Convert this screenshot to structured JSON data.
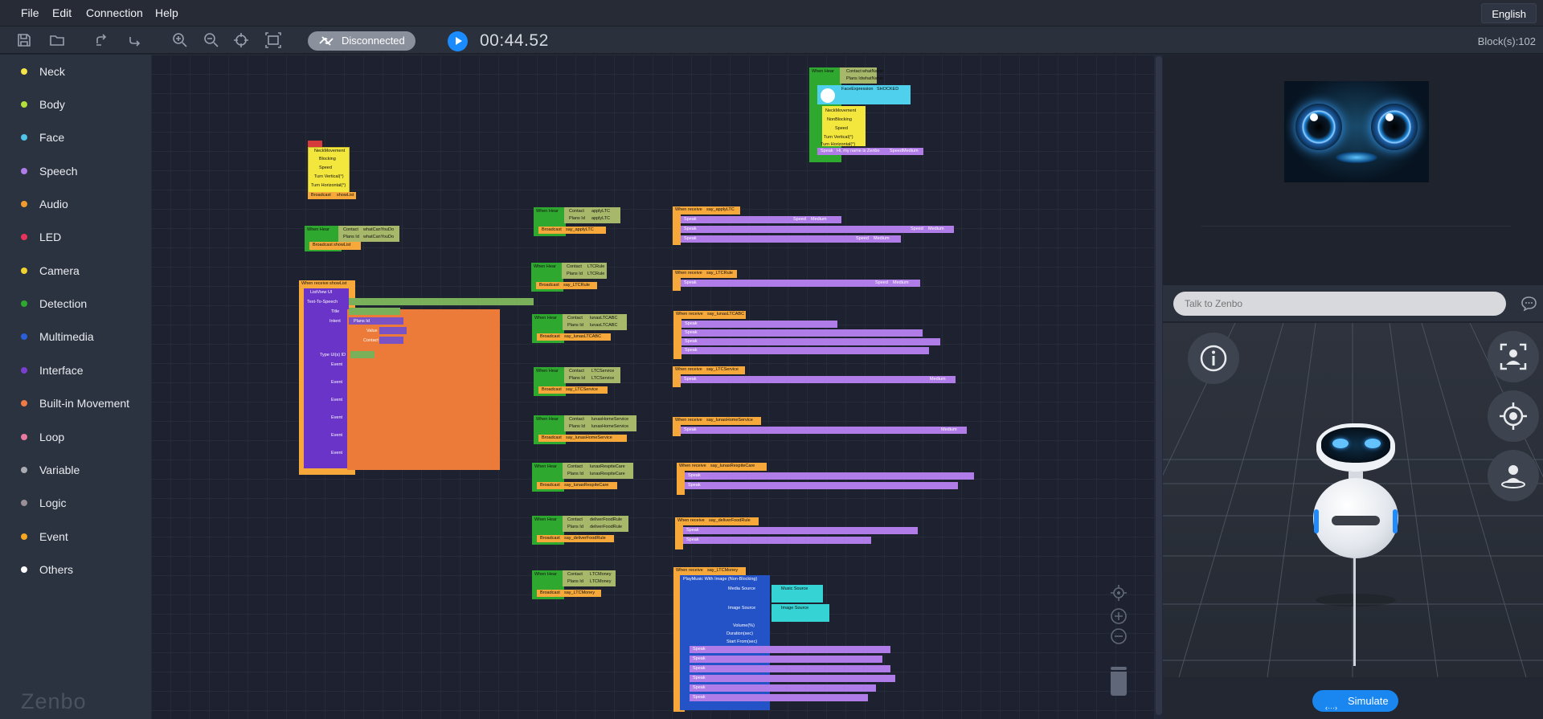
{
  "menu": {
    "file": "File",
    "edit": "Edit",
    "connection": "Connection",
    "help": "Help",
    "language": "English"
  },
  "toolbar": {
    "connection_status": "Disconnected",
    "timer": "00:44.52",
    "block_count": "Block(s):102"
  },
  "categories": [
    {
      "label": "Neck",
      "color": "#f5e447"
    },
    {
      "label": "Body",
      "color": "#b3e03a"
    },
    {
      "label": "Face",
      "color": "#4fc3e8"
    },
    {
      "label": "Speech",
      "color": "#b07ce8"
    },
    {
      "label": "Audio",
      "color": "#f29a2e"
    },
    {
      "label": "LED",
      "color": "#e8345a"
    },
    {
      "label": "Camera",
      "color": "#f2d22e"
    },
    {
      "label": "Detection",
      "color": "#2fa830"
    },
    {
      "label": "Multimedia",
      "color": "#2b5fd9"
    },
    {
      "label": "Interface",
      "color": "#7a3fd0"
    },
    {
      "label": "Built-in Movement",
      "color": "#f07a45"
    },
    {
      "label": "Loop",
      "color": "#e87aa0"
    },
    {
      "label": "Variable",
      "color": "#a9abb0"
    },
    {
      "label": "Logic",
      "color": "#9a8f96"
    },
    {
      "label": "Event",
      "color": "#f5a623"
    },
    {
      "label": "Others",
      "color": "#ffffff"
    }
  ],
  "brand": "Zenbo",
  "blocks": {
    "neck_top": [
      "NeckMovement",
      "Blocking",
      "Speed",
      "Turn Vertical(°)",
      "Turn Horizontal(°)",
      "Broadcast",
      "showList"
    ],
    "hear_top": [
      "When Hear",
      "Contact",
      "whatCanYouDo",
      "Plans Id",
      "whatCanYouDo",
      "Broadcast",
      "showList"
    ],
    "list_view": [
      "When receive",
      "showList",
      "ListView UI",
      "Text-To-Speech",
      "Title",
      "Intent",
      "Plans Id",
      "Value",
      "Contact",
      "Type Ui(s) ID",
      "Event",
      "Event",
      "Event",
      "Event",
      "Event",
      "Event",
      "Event",
      "Event",
      "Event"
    ],
    "start_block": [
      "When Hear",
      "Contact",
      "whatName",
      "Plans Id",
      "whatName",
      "FaceExpression",
      "SHOCKED",
      "NeckMovement",
      "NonBlocking",
      "Speed",
      "Turn Vertical(°)",
      "Turn Horizontal(°)",
      "Speak",
      "Hi, my name is Zenbo",
      "Speed",
      "Medium"
    ],
    "hear_blocks": [
      {
        "contact": "applyLTC",
        "plans": "applyLTC",
        "broadcast": "say_applyLTC"
      },
      {
        "contact": "LTCRule",
        "plans": "LTCRule",
        "broadcast": "say_LTCRule"
      },
      {
        "contact": "lunasLTCABC",
        "plans": "lunasLTCABC",
        "broadcast": "say_lunasLTCABC"
      },
      {
        "contact": "LTCService",
        "plans": "LTCService",
        "broadcast": "say_LTCService"
      },
      {
        "contact": "lunasHomeService",
        "plans": "lunasHomeService",
        "broadcast": "say_lunasHomeService"
      },
      {
        "contact": "lunasRespiteCare",
        "plans": "lunasRespiteCare",
        "broadcast": "say_lunasRespiteCare"
      },
      {
        "contact": "deliverFoodRule",
        "plans": "deliverFoodRule",
        "broadcast": "say_deliverFoodRule"
      },
      {
        "contact": "LTCMoney",
        "plans": "LTCMoney",
        "broadcast": "say_LTCMoney"
      }
    ],
    "receive_blocks": [
      "say_applyLTC",
      "say_LTCRule",
      "say_lunasLTCABC",
      "say_LTCService",
      "say_lunasHomeService",
      "say_lunasRespiteCare",
      "say_deliverFoodRule",
      "say_LTCMoney"
    ],
    "play_music": [
      "PlayMusic With Image (Non-Blocking)",
      "Media Source",
      "Music Source",
      "Image Source",
      "Image Source",
      "Volume(%)",
      "Duration(sec)",
      "Start From(sec)"
    ],
    "speak_label": "Speak",
    "speed_label": "Speed",
    "medium": "Medium",
    "when_hear": "When Hear",
    "when_receive": "When receive",
    "contact": "Contact",
    "plans_id": "Plans Id",
    "broadcast": "Broadcast"
  },
  "talk": {
    "placeholder": "Talk to Zenbo"
  },
  "simulate": {
    "label": "Simulate"
  },
  "icons": {
    "info": "info-icon",
    "face_track": "face-track-icon",
    "target": "target-icon",
    "user": "user-icon"
  }
}
